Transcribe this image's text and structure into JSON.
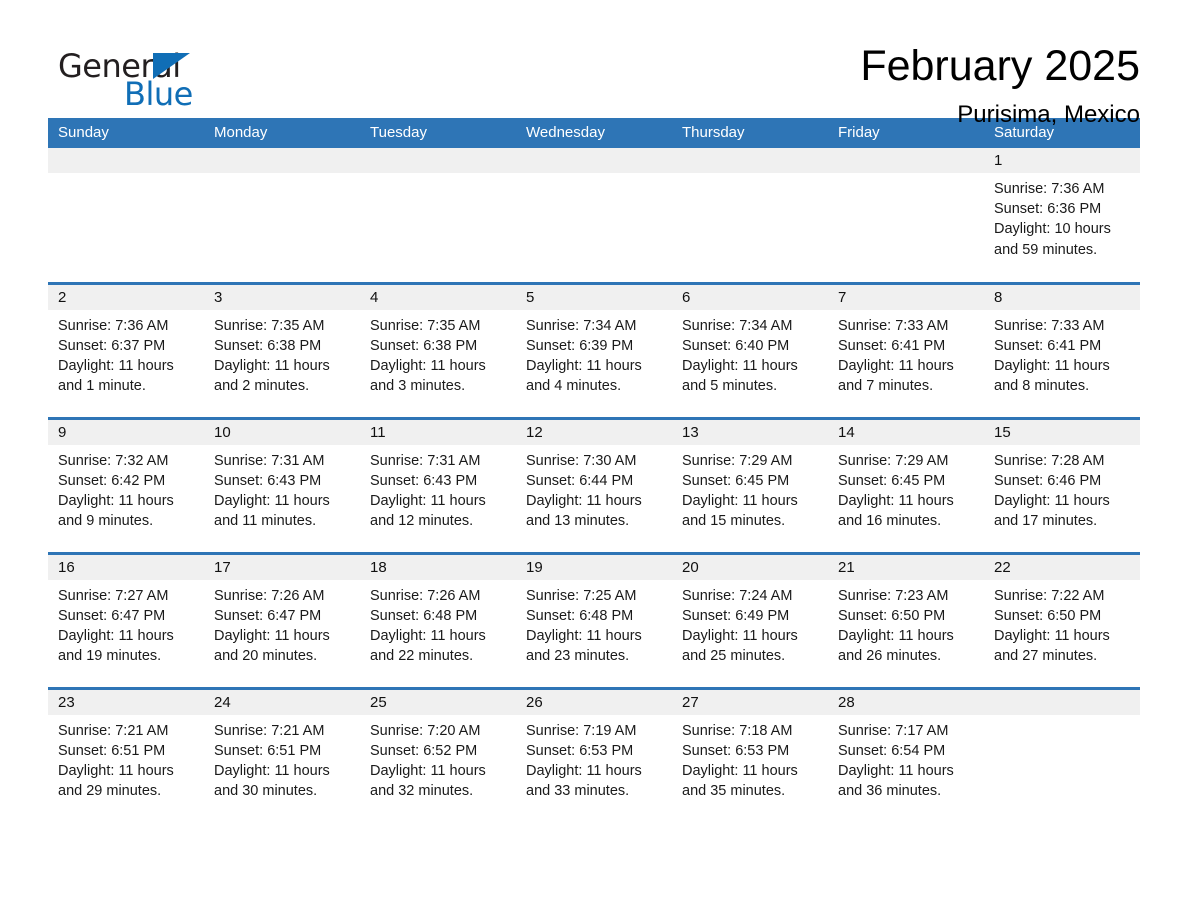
{
  "brand": {
    "name_part1": "General",
    "name_part2": "Blue",
    "triangle_color": "#106eb6"
  },
  "header": {
    "title": "February 2025",
    "subtitle": "Purisima, Mexico",
    "accent_color": "#2e75b6",
    "daynum_bg": "#f0f0f0"
  },
  "weekday_headers": [
    "Sunday",
    "Monday",
    "Tuesday",
    "Wednesday",
    "Thursday",
    "Friday",
    "Saturday"
  ],
  "weeks": [
    [
      {
        "day": "",
        "sunrise": "",
        "sunset": "",
        "daylight_line1": "",
        "daylight_line2": ""
      },
      {
        "day": "",
        "sunrise": "",
        "sunset": "",
        "daylight_line1": "",
        "daylight_line2": ""
      },
      {
        "day": "",
        "sunrise": "",
        "sunset": "",
        "daylight_line1": "",
        "daylight_line2": ""
      },
      {
        "day": "",
        "sunrise": "",
        "sunset": "",
        "daylight_line1": "",
        "daylight_line2": ""
      },
      {
        "day": "",
        "sunrise": "",
        "sunset": "",
        "daylight_line1": "",
        "daylight_line2": ""
      },
      {
        "day": "",
        "sunrise": "",
        "sunset": "",
        "daylight_line1": "",
        "daylight_line2": ""
      },
      {
        "day": "1",
        "sunrise": "Sunrise: 7:36 AM",
        "sunset": "Sunset: 6:36 PM",
        "daylight_line1": "Daylight: 10 hours",
        "daylight_line2": "and 59 minutes."
      }
    ],
    [
      {
        "day": "2",
        "sunrise": "Sunrise: 7:36 AM",
        "sunset": "Sunset: 6:37 PM",
        "daylight_line1": "Daylight: 11 hours",
        "daylight_line2": "and 1 minute."
      },
      {
        "day": "3",
        "sunrise": "Sunrise: 7:35 AM",
        "sunset": "Sunset: 6:38 PM",
        "daylight_line1": "Daylight: 11 hours",
        "daylight_line2": "and 2 minutes."
      },
      {
        "day": "4",
        "sunrise": "Sunrise: 7:35 AM",
        "sunset": "Sunset: 6:38 PM",
        "daylight_line1": "Daylight: 11 hours",
        "daylight_line2": "and 3 minutes."
      },
      {
        "day": "5",
        "sunrise": "Sunrise: 7:34 AM",
        "sunset": "Sunset: 6:39 PM",
        "daylight_line1": "Daylight: 11 hours",
        "daylight_line2": "and 4 minutes."
      },
      {
        "day": "6",
        "sunrise": "Sunrise: 7:34 AM",
        "sunset": "Sunset: 6:40 PM",
        "daylight_line1": "Daylight: 11 hours",
        "daylight_line2": "and 5 minutes."
      },
      {
        "day": "7",
        "sunrise": "Sunrise: 7:33 AM",
        "sunset": "Sunset: 6:41 PM",
        "daylight_line1": "Daylight: 11 hours",
        "daylight_line2": "and 7 minutes."
      },
      {
        "day": "8",
        "sunrise": "Sunrise: 7:33 AM",
        "sunset": "Sunset: 6:41 PM",
        "daylight_line1": "Daylight: 11 hours",
        "daylight_line2": "and 8 minutes."
      }
    ],
    [
      {
        "day": "9",
        "sunrise": "Sunrise: 7:32 AM",
        "sunset": "Sunset: 6:42 PM",
        "daylight_line1": "Daylight: 11 hours",
        "daylight_line2": "and 9 minutes."
      },
      {
        "day": "10",
        "sunrise": "Sunrise: 7:31 AM",
        "sunset": "Sunset: 6:43 PM",
        "daylight_line1": "Daylight: 11 hours",
        "daylight_line2": "and 11 minutes."
      },
      {
        "day": "11",
        "sunrise": "Sunrise: 7:31 AM",
        "sunset": "Sunset: 6:43 PM",
        "daylight_line1": "Daylight: 11 hours",
        "daylight_line2": "and 12 minutes."
      },
      {
        "day": "12",
        "sunrise": "Sunrise: 7:30 AM",
        "sunset": "Sunset: 6:44 PM",
        "daylight_line1": "Daylight: 11 hours",
        "daylight_line2": "and 13 minutes."
      },
      {
        "day": "13",
        "sunrise": "Sunrise: 7:29 AM",
        "sunset": "Sunset: 6:45 PM",
        "daylight_line1": "Daylight: 11 hours",
        "daylight_line2": "and 15 minutes."
      },
      {
        "day": "14",
        "sunrise": "Sunrise: 7:29 AM",
        "sunset": "Sunset: 6:45 PM",
        "daylight_line1": "Daylight: 11 hours",
        "daylight_line2": "and 16 minutes."
      },
      {
        "day": "15",
        "sunrise": "Sunrise: 7:28 AM",
        "sunset": "Sunset: 6:46 PM",
        "daylight_line1": "Daylight: 11 hours",
        "daylight_line2": "and 17 minutes."
      }
    ],
    [
      {
        "day": "16",
        "sunrise": "Sunrise: 7:27 AM",
        "sunset": "Sunset: 6:47 PM",
        "daylight_line1": "Daylight: 11 hours",
        "daylight_line2": "and 19 minutes."
      },
      {
        "day": "17",
        "sunrise": "Sunrise: 7:26 AM",
        "sunset": "Sunset: 6:47 PM",
        "daylight_line1": "Daylight: 11 hours",
        "daylight_line2": "and 20 minutes."
      },
      {
        "day": "18",
        "sunrise": "Sunrise: 7:26 AM",
        "sunset": "Sunset: 6:48 PM",
        "daylight_line1": "Daylight: 11 hours",
        "daylight_line2": "and 22 minutes."
      },
      {
        "day": "19",
        "sunrise": "Sunrise: 7:25 AM",
        "sunset": "Sunset: 6:48 PM",
        "daylight_line1": "Daylight: 11 hours",
        "daylight_line2": "and 23 minutes."
      },
      {
        "day": "20",
        "sunrise": "Sunrise: 7:24 AM",
        "sunset": "Sunset: 6:49 PM",
        "daylight_line1": "Daylight: 11 hours",
        "daylight_line2": "and 25 minutes."
      },
      {
        "day": "21",
        "sunrise": "Sunrise: 7:23 AM",
        "sunset": "Sunset: 6:50 PM",
        "daylight_line1": "Daylight: 11 hours",
        "daylight_line2": "and 26 minutes."
      },
      {
        "day": "22",
        "sunrise": "Sunrise: 7:22 AM",
        "sunset": "Sunset: 6:50 PM",
        "daylight_line1": "Daylight: 11 hours",
        "daylight_line2": "and 27 minutes."
      }
    ],
    [
      {
        "day": "23",
        "sunrise": "Sunrise: 7:21 AM",
        "sunset": "Sunset: 6:51 PM",
        "daylight_line1": "Daylight: 11 hours",
        "daylight_line2": "and 29 minutes."
      },
      {
        "day": "24",
        "sunrise": "Sunrise: 7:21 AM",
        "sunset": "Sunset: 6:51 PM",
        "daylight_line1": "Daylight: 11 hours",
        "daylight_line2": "and 30 minutes."
      },
      {
        "day": "25",
        "sunrise": "Sunrise: 7:20 AM",
        "sunset": "Sunset: 6:52 PM",
        "daylight_line1": "Daylight: 11 hours",
        "daylight_line2": "and 32 minutes."
      },
      {
        "day": "26",
        "sunrise": "Sunrise: 7:19 AM",
        "sunset": "Sunset: 6:53 PM",
        "daylight_line1": "Daylight: 11 hours",
        "daylight_line2": "and 33 minutes."
      },
      {
        "day": "27",
        "sunrise": "Sunrise: 7:18 AM",
        "sunset": "Sunset: 6:53 PM",
        "daylight_line1": "Daylight: 11 hours",
        "daylight_line2": "and 35 minutes."
      },
      {
        "day": "28",
        "sunrise": "Sunrise: 7:17 AM",
        "sunset": "Sunset: 6:54 PM",
        "daylight_line1": "Daylight: 11 hours",
        "daylight_line2": "and 36 minutes."
      },
      {
        "day": "",
        "sunrise": "",
        "sunset": "",
        "daylight_line1": "",
        "daylight_line2": ""
      }
    ]
  ]
}
